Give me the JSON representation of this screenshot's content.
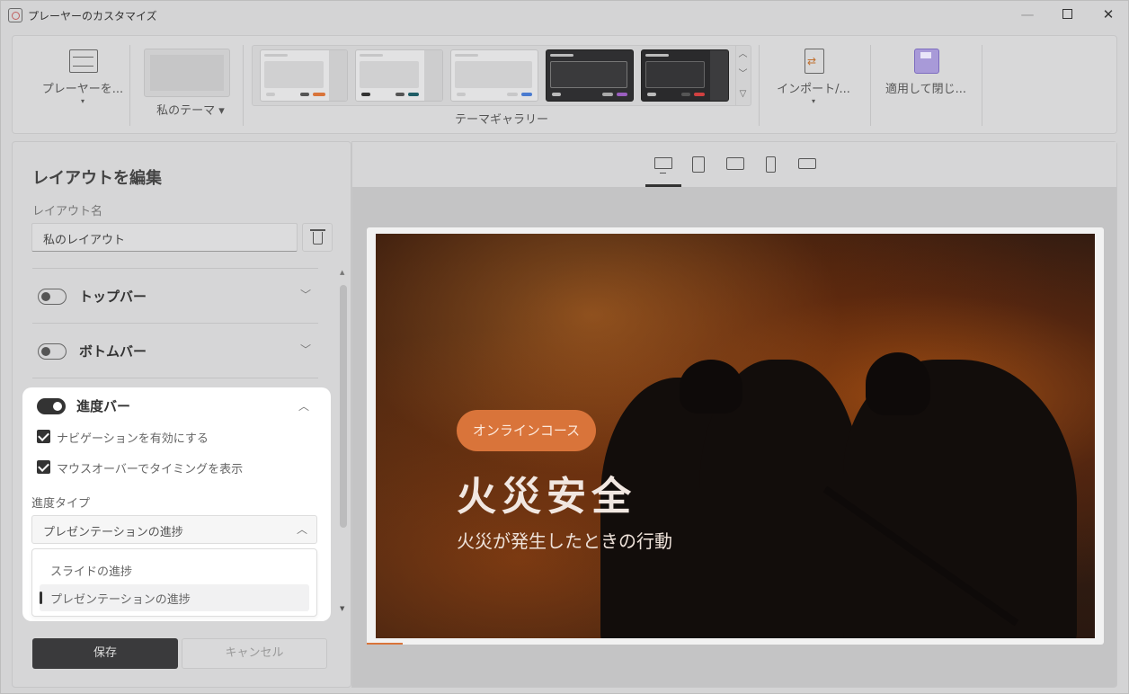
{
  "window": {
    "title": "プレーヤーのカスタマイズ",
    "minimize": "—",
    "close": "✕"
  },
  "ribbon": {
    "player_label": "プレーヤーを...",
    "player_caret": "▾",
    "mytheme_label": "私のテーマ ▾",
    "gallery_label": "テーマギャラリー",
    "gallery_scroll": [
      "︿",
      "﹀",
      "▽"
    ],
    "import_label": "インポート/...",
    "import_caret": "▾",
    "apply_label": "適用して閉じ..."
  },
  "themes": [
    {
      "style": "light",
      "bg": "#e2e2e3",
      "screen": "#d0d0d1",
      "side": "#cdcdce",
      "dots": [
        "#c8c8c9",
        "#555",
        "#d9743a"
      ]
    },
    {
      "style": "light",
      "bg": "#e2e2e3",
      "screen": "#d0d0d1",
      "side": "#cdcdce",
      "dots": [
        "#333",
        "#555",
        "#1f5d66"
      ]
    },
    {
      "style": "light",
      "bg": "#e2e2e3",
      "screen": "#d0d0d1",
      "side": "#e2e2e3",
      "dots": [
        "#c8c8c9",
        "#bbb",
        "#4a7bd0"
      ]
    },
    {
      "style": "dark",
      "bg": "#2f2f31",
      "screen": "#3a3a3c",
      "side": "#2f2f31",
      "dots": [
        "#bbb",
        "#aaa",
        "#9b5fc0"
      ]
    },
    {
      "style": "dark",
      "bg": "#2a2a2c",
      "screen": "#353537",
      "side": "#3c3c3e",
      "dots": [
        "#bbb",
        "#555",
        "#d04040"
      ]
    }
  ],
  "left_panel": {
    "title": "レイアウトを編集",
    "name_label": "レイアウト名",
    "name_value": "私のレイアウト",
    "sections": [
      {
        "label": "トップバー",
        "enabled": false
      },
      {
        "label": "ボトムバー",
        "enabled": false
      }
    ],
    "progress": {
      "label": "進度バー",
      "enabled": true,
      "options": [
        {
          "label": "ナビゲーションを有効にする",
          "checked": true
        },
        {
          "label": "マウスオーバーでタイミングを表示",
          "checked": true
        }
      ],
      "type_label": "進度タイプ",
      "type_value": "プレゼンテーションの進捗",
      "dropdown": [
        "スライドの進捗",
        "プレゼンテーションの進捗"
      ]
    },
    "save": "保存",
    "cancel": "キャンセル"
  },
  "preview": {
    "devices": [
      "desktop",
      "tablet-portrait",
      "tablet-landscape",
      "phone-portrait",
      "phone-landscape"
    ],
    "badge": "オンラインコース",
    "title": "火災安全",
    "subtitle": "火災が発生したときの行動"
  }
}
